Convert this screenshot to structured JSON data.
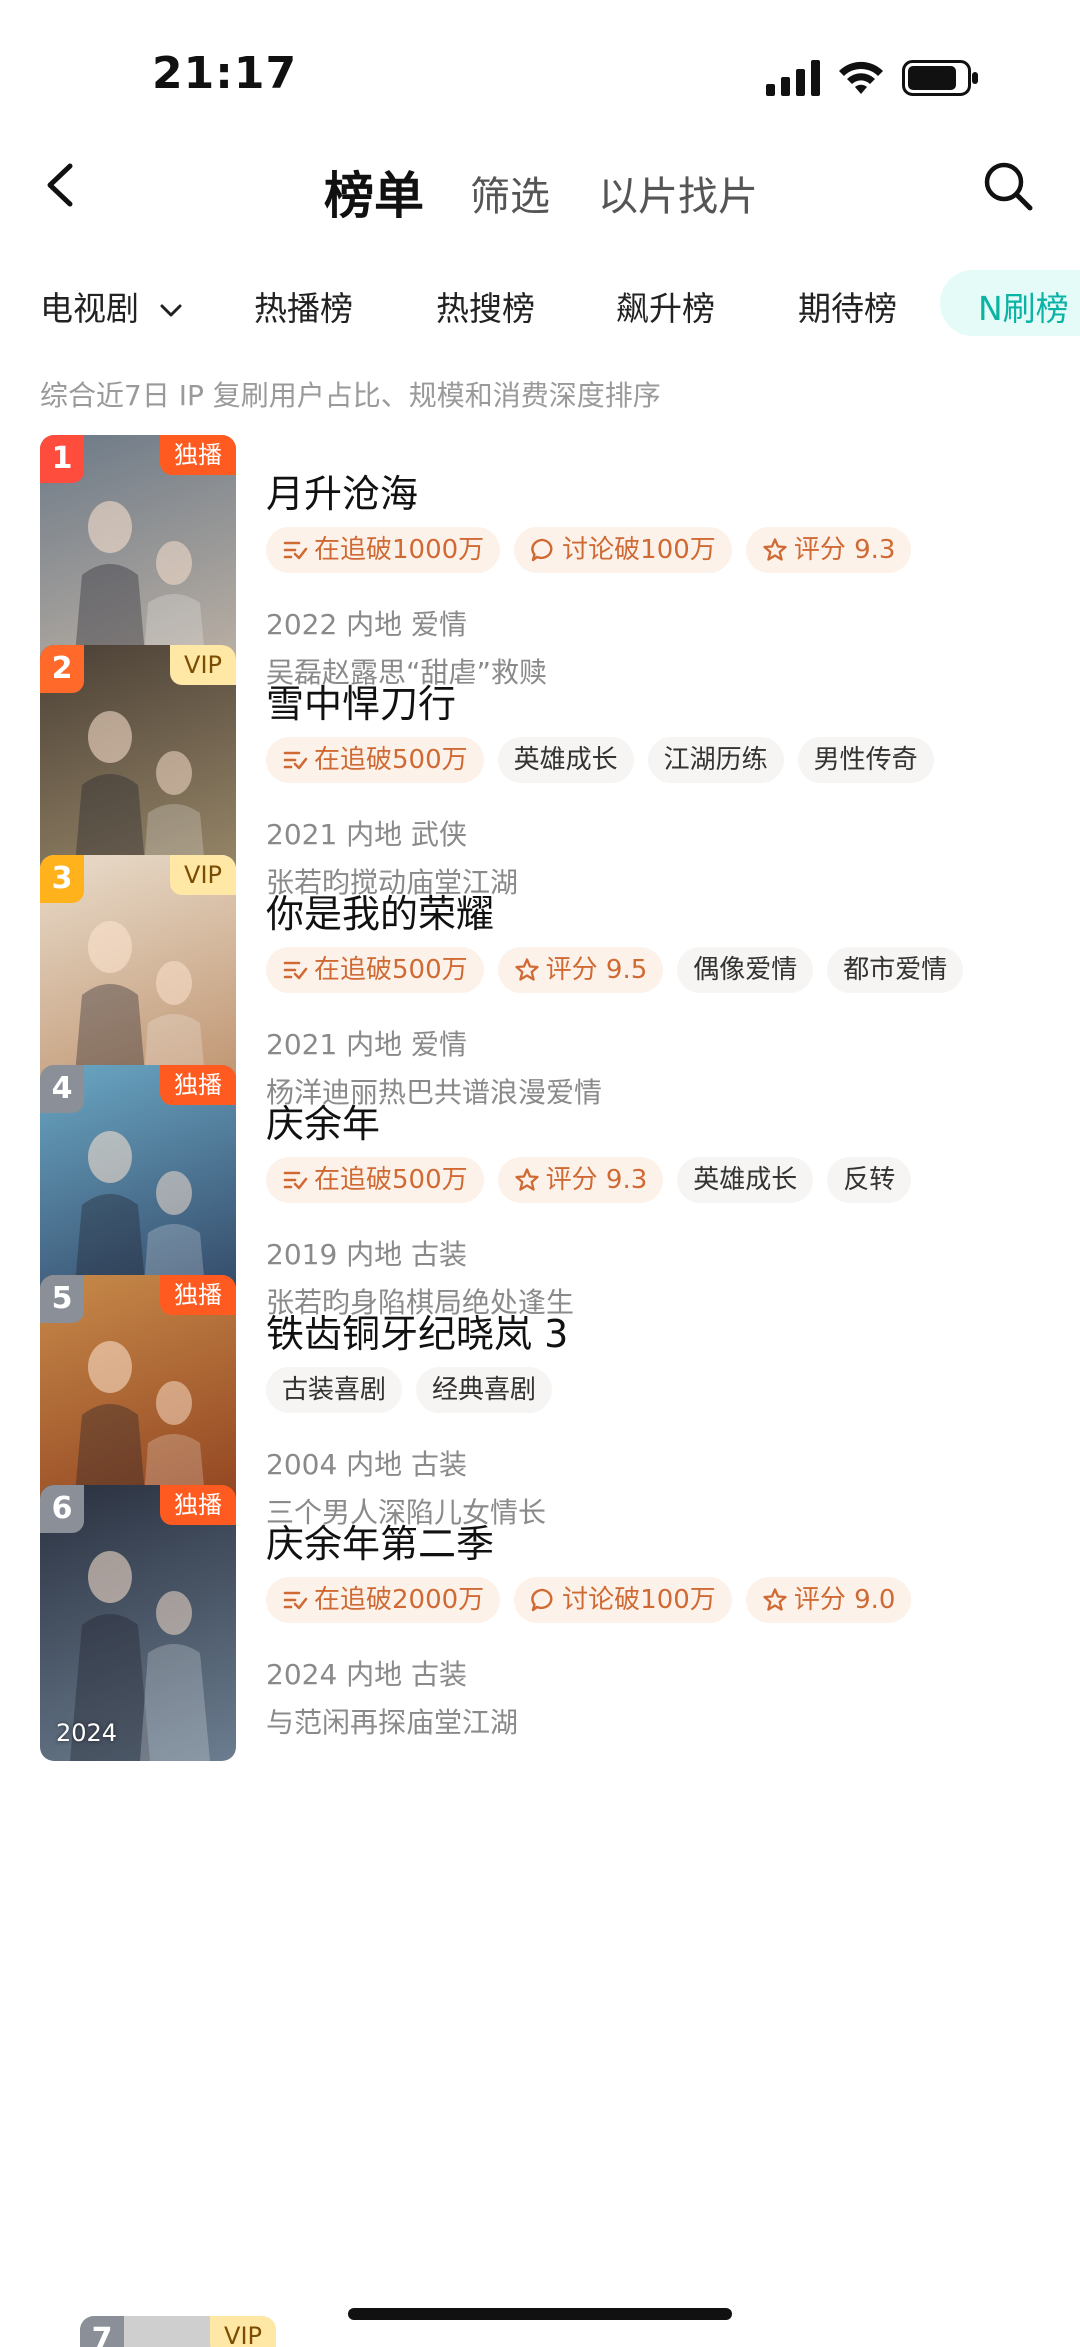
{
  "status": {
    "time": "21:17"
  },
  "nav": {
    "active": "榜单",
    "filter": "筛选",
    "find_by_clip": "以片找片"
  },
  "categories": {
    "dropdown": "电视剧",
    "tabs": [
      "热播榜",
      "热搜榜",
      "飙升榜",
      "期待榜"
    ],
    "active": "N刷榜"
  },
  "description": "综合近7日 IP 复刷用户占比、规模和消费深度排序",
  "items": [
    {
      "rank": "1",
      "badge": "独播",
      "year": "2022",
      "title": "月升沧海",
      "tags": [
        {
          "icon": "follow-icon",
          "text": "在追破1000万",
          "hot": true
        },
        {
          "icon": "comment-icon",
          "text": "讨论破100万",
          "hot": true
        },
        {
          "icon": "star-icon",
          "text": "评分 9.3",
          "hot": true
        }
      ],
      "meta": "2022 内地 爱情",
      "sub": "吴磊赵露思“甜虐”救赎"
    },
    {
      "rank": "2",
      "badge": "VIP",
      "year": "2021",
      "title": "雪中悍刀行",
      "tags": [
        {
          "icon": "follow-icon",
          "text": "在追破500万",
          "hot": true
        },
        {
          "icon": "",
          "text": "英雄成长",
          "hot": false
        },
        {
          "icon": "",
          "text": "江湖历练",
          "hot": false
        },
        {
          "icon": "",
          "text": "男性传奇",
          "hot": false
        }
      ],
      "meta": "2021 内地 武侠",
      "sub": "张若昀搅动庙堂江湖"
    },
    {
      "rank": "3",
      "badge": "VIP",
      "year": "2021",
      "title": "你是我的荣耀",
      "tags": [
        {
          "icon": "follow-icon",
          "text": "在追破500万",
          "hot": true
        },
        {
          "icon": "star-icon",
          "text": "评分 9.5",
          "hot": true
        },
        {
          "icon": "",
          "text": "偶像爱情",
          "hot": false
        },
        {
          "icon": "",
          "text": "都市爱情",
          "hot": false
        }
      ],
      "meta": "2021 内地 爱情",
      "sub": "杨洋迪丽热巴共谱浪漫爱情"
    },
    {
      "rank": "4",
      "badge": "独播",
      "year": "2019",
      "title": "庆余年",
      "tags": [
        {
          "icon": "follow-icon",
          "text": "在追破500万",
          "hot": true
        },
        {
          "icon": "star-icon",
          "text": "评分 9.3",
          "hot": true
        },
        {
          "icon": "",
          "text": "英雄成长",
          "hot": false
        },
        {
          "icon": "",
          "text": "反转",
          "hot": false
        }
      ],
      "meta": "2019 内地 古装",
      "sub": "张若昀身陷棋局绝处逢生"
    },
    {
      "rank": "5",
      "badge": "独播",
      "year": "2004",
      "title": "铁齿铜牙纪晓岚 3",
      "tags": [
        {
          "icon": "",
          "text": "古装喜剧",
          "hot": false
        },
        {
          "icon": "",
          "text": "经典喜剧",
          "hot": false
        }
      ],
      "meta": "2004 内地 古装",
      "sub": "三个男人深陷儿女情长"
    },
    {
      "rank": "6",
      "badge": "独播",
      "year": "2024",
      "title": "庆余年第二季",
      "tags": [
        {
          "icon": "follow-icon",
          "text": "在追破2000万",
          "hot": true
        },
        {
          "icon": "comment-icon",
          "text": "讨论破100万",
          "hot": true
        },
        {
          "icon": "star-icon",
          "text": "评分 9.0",
          "hot": true
        }
      ],
      "meta": "2024 内地 古装",
      "sub": "与范闲再探庙堂江湖"
    }
  ],
  "next_item": {
    "rank": "7",
    "badge": "VIP"
  },
  "colors": {
    "accent": "#0bb3a4",
    "rank_colors": [
      "#ff4d3d",
      "#ff6a2b",
      "#ffb21c",
      "#8a8f98",
      "#8a8f98",
      "#8a8f98",
      "#8a8f98"
    ],
    "poster_colors": [
      [
        "#6d7a88",
        "#c7b8a8"
      ],
      [
        "#4b4036",
        "#a39270"
      ],
      [
        "#e9dccb",
        "#b98a63"
      ],
      [
        "#6aa7c4",
        "#2b3b5a"
      ],
      [
        "#c78a4a",
        "#8a3a1a"
      ],
      [
        "#2a3140",
        "#6b7d8f"
      ]
    ]
  }
}
